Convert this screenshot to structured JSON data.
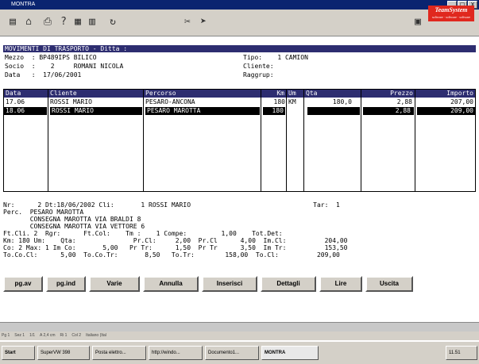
{
  "window": {
    "title": "MONTRA"
  },
  "window_buttons": [
    "_",
    "□",
    "X"
  ],
  "toolbar": {
    "logo_main": "TeamSystem",
    "logo_sub": "software · software · software"
  },
  "screen": {
    "header": "MOVIMENTI DI TRASPORTO - Ditta :",
    "mezzo": "Mezzo  : BP489IPS BILICO",
    "tipo": "Tipo:    1 CAMION",
    "socio": "Socio  :    2     ROMANI NICOLA",
    "cliente": "Cliente:",
    "data": "Data   :  17/06/2001",
    "raggrup": "Raggrup:",
    "columns": [
      "Data",
      "Cliente",
      "Percorso",
      "Km",
      "Um",
      "Qta",
      "Prezzo",
      "Importo"
    ],
    "rows": [
      [
        "17.06",
        "ROSSI MARIO",
        "PESARO-ANCONA",
        "180",
        "KM",
        "180,0",
        "2,88",
        "207,00"
      ],
      [
        "18.06",
        "ROSSI MARIO",
        "PESARO MAROTTA",
        "180",
        "",
        "",
        "2,88",
        "209,00"
      ]
    ],
    "detail": [
      "Nr:      2 Dt:18/06/2002 Cli:       1 ROSSI MARIO                                Tar:  1",
      "Perc.  PESARO MAROTTA",
      "       CONSEGNA MAROTTA VIA BRALDI 8",
      "       CONSEGNA MAROTTA VIA VETTORE 6",
      "Ft.Cli. 2  Rgr:      Ft.Col:    Tm :    1 Compe:         1,00    Tot.Det:",
      "Km: 180 Um:    Qta:               Pr.Cl:     2,00  Pr.Cl      4,00  Im.Cl:          204,00",
      "Co: 2 Max: 1 Im Co:       5,00   Pr Tr:      1,50  Pr Tr      3,50  Im Tr:          153,50",
      "To.Co.Cl:      5,00  To.Co.Tr:       8,50   To.Tr:        158,00  To.Cl:          209,00"
    ],
    "buttons": [
      "pg.av",
      "pg.ind",
      "Varie",
      "Annulla",
      "Inserisci",
      "Dettagli",
      "Lire",
      "Uscita"
    ]
  },
  "status_bar": [
    "Pg 1",
    "Sez 1",
    "1/1",
    "A 2,4 cm",
    "Ri 1",
    "Col 2",
    "Italiano (Ital"
  ],
  "taskbar": {
    "start": "Start",
    "items": [
      "SuperVW 398",
      "Posta elettro...",
      "http://windo...",
      "Documento1...",
      "MONTRA"
    ],
    "clock": "11.51"
  }
}
